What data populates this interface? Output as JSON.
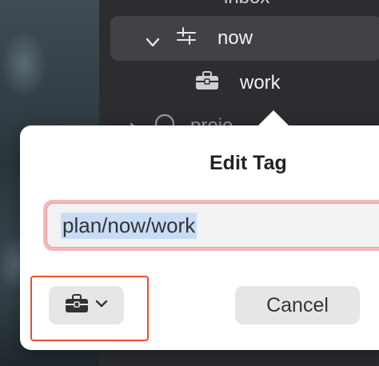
{
  "sidebar": {
    "items": [
      {
        "label": "inbox"
      },
      {
        "label": "now"
      },
      {
        "label": "work"
      },
      {
        "label": "proje"
      }
    ]
  },
  "dialog": {
    "title": "Edit Tag",
    "tag_value": "plan/now/work",
    "icon_button_icon": "briefcase-icon",
    "cancel_label": "Cancel"
  },
  "colors": {
    "highlight_border": "#e8502f",
    "input_focus_ring": "#f3b9b9",
    "selection": "#c8dcf6"
  }
}
